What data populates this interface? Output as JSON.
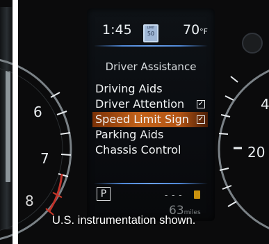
{
  "screen": {
    "time": "1:45",
    "speed_limit_badge": {
      "label": "LIMIT",
      "value": "50"
    },
    "temperature": "70",
    "temperature_unit": "°F",
    "menu_title": "Driver Assistance",
    "menu_items": [
      {
        "label": "Driving Aids",
        "checked": false,
        "selected": false
      },
      {
        "label": "Driver Attention",
        "checked": true,
        "selected": false
      },
      {
        "label": "Speed Limit Sign",
        "checked": true,
        "selected": true
      },
      {
        "label": "Parking Aids",
        "checked": false,
        "selected": false
      },
      {
        "label": "Chassis Control",
        "checked": false,
        "selected": false
      }
    ],
    "gear": "P",
    "fuel_placeholder": "- - -",
    "range_value": "63",
    "range_unit": "miles"
  },
  "tachometer": {
    "ticks": [
      "6",
      "7",
      "8"
    ]
  },
  "speedometer": {
    "ticks": [
      "4",
      "20"
    ]
  },
  "caption": "U.S. instrumentation shown.",
  "colors": {
    "selected_row": "#c2621a",
    "separator_line": "#5b93e0",
    "fuel_icon": "#c9910e"
  }
}
